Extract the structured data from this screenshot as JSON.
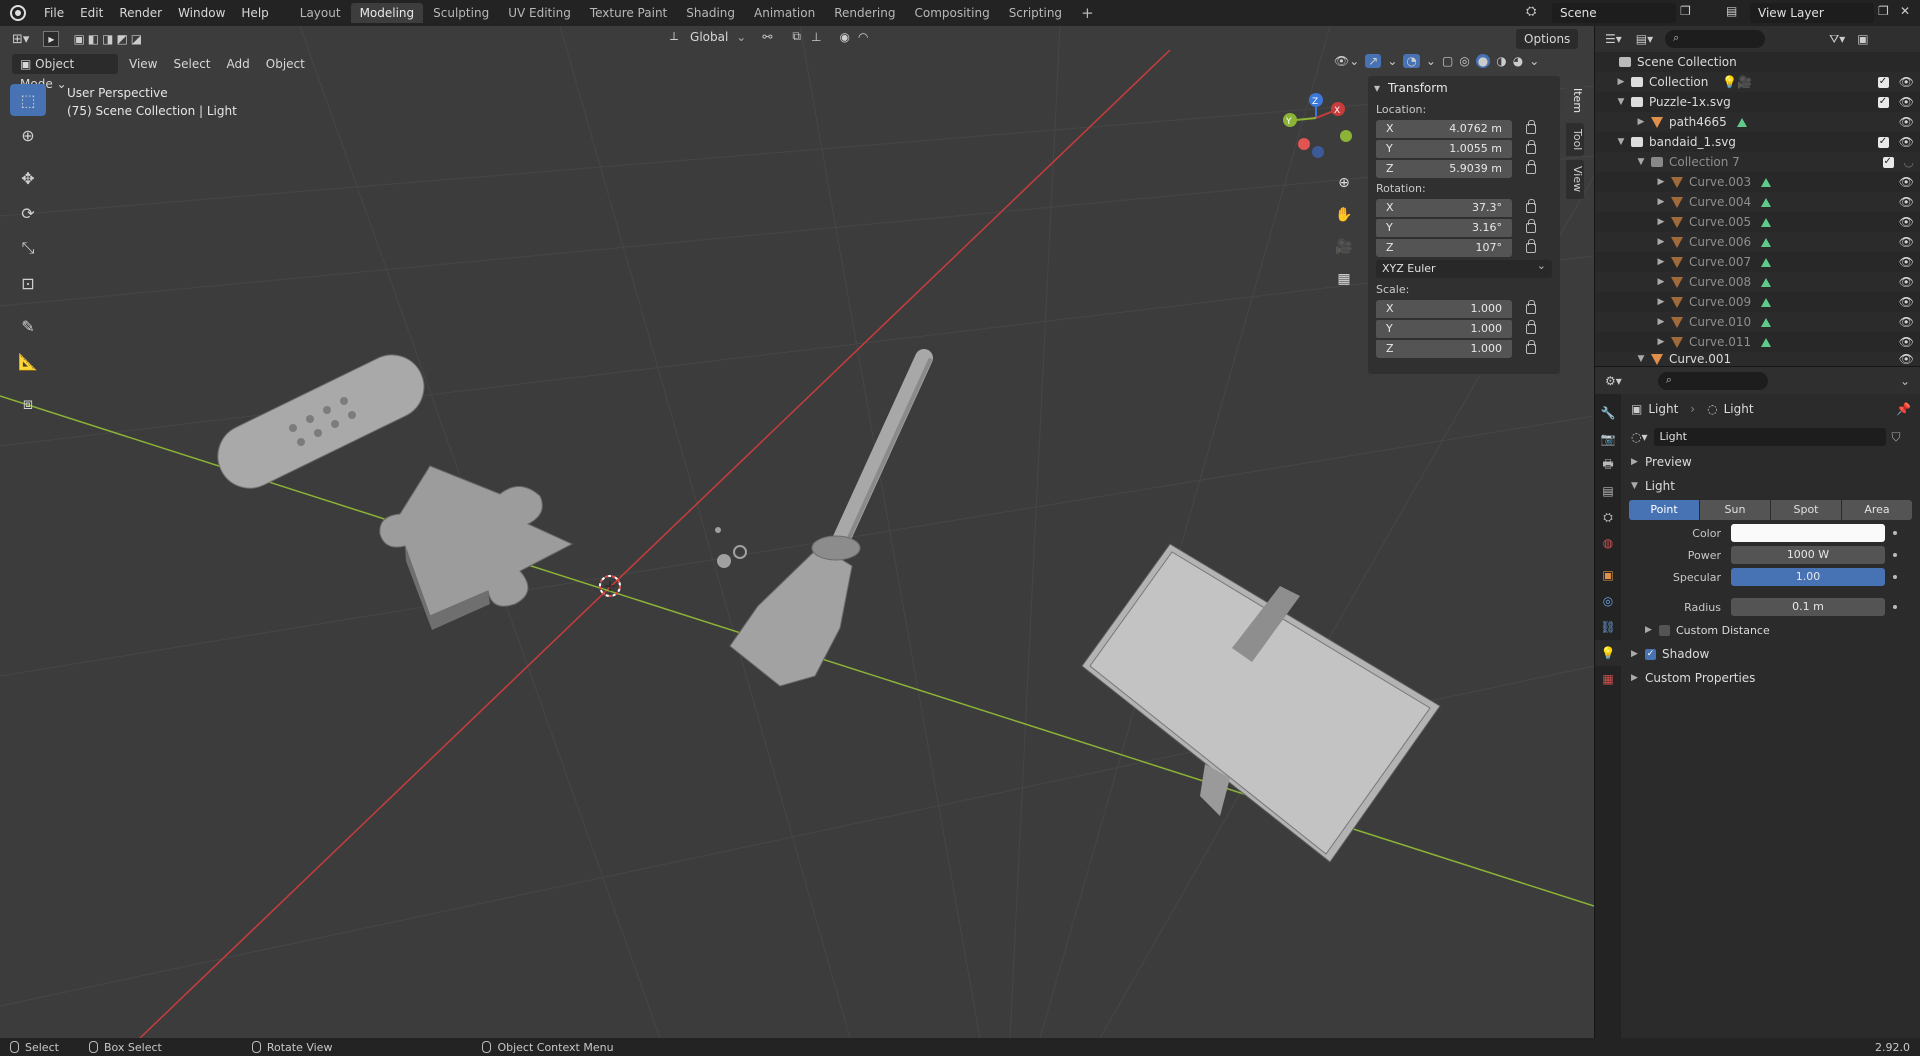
{
  "topbar": {
    "menus": [
      "File",
      "Edit",
      "Render",
      "Window",
      "Help"
    ],
    "workspaces": [
      "Layout",
      "Modeling",
      "Sculpting",
      "UV Editing",
      "Texture Paint",
      "Shading",
      "Animation",
      "Rendering",
      "Compositing",
      "Scripting"
    ],
    "active_workspace": "Modeling",
    "add_tab": "+",
    "scene": "Scene",
    "view_layer": "View Layer"
  },
  "viewport": {
    "mode": "Object Mode",
    "menus": [
      "View",
      "Select",
      "Add",
      "Object"
    ],
    "orientation": "Global",
    "options": "Options",
    "info_line1": "User Perspective",
    "info_line2": "(75) Scene Collection | Light"
  },
  "npanel": {
    "title": "Transform",
    "location_label": "Location:",
    "location": [
      {
        "axis": "X",
        "value": "4.0762 m"
      },
      {
        "axis": "Y",
        "value": "1.0055 m"
      },
      {
        "axis": "Z",
        "value": "5.9039 m"
      }
    ],
    "rotation_label": "Rotation:",
    "rotation": [
      {
        "axis": "X",
        "value": "37.3°"
      },
      {
        "axis": "Y",
        "value": "3.16°"
      },
      {
        "axis": "Z",
        "value": "107°"
      }
    ],
    "rotation_mode": "XYZ Euler",
    "scale_label": "Scale:",
    "scale": [
      {
        "axis": "X",
        "value": "1.000"
      },
      {
        "axis": "Y",
        "value": "1.000"
      },
      {
        "axis": "Z",
        "value": "1.000"
      }
    ],
    "tabs": [
      "Item",
      "Tool",
      "View"
    ]
  },
  "outliner": {
    "rows": [
      {
        "name": "Scene Collection",
        "indent": 0,
        "type": "scene"
      },
      {
        "name": "Collection",
        "indent": 1,
        "type": "coll"
      },
      {
        "name": "Puzzle-1x.svg",
        "indent": 1,
        "type": "coll"
      },
      {
        "name": "path4665",
        "indent": 2,
        "type": "curve"
      },
      {
        "name": "bandaid_1.svg",
        "indent": 1,
        "type": "coll"
      },
      {
        "name": "Collection 7",
        "indent": 2,
        "type": "coll",
        "dim": true
      },
      {
        "name": "Curve.003",
        "indent": 3,
        "type": "curve",
        "dim": true
      },
      {
        "name": "Curve.004",
        "indent": 3,
        "type": "curve",
        "dim": true
      },
      {
        "name": "Curve.005",
        "indent": 3,
        "type": "curve",
        "dim": true
      },
      {
        "name": "Curve.006",
        "indent": 3,
        "type": "curve",
        "dim": true
      },
      {
        "name": "Curve.007",
        "indent": 3,
        "type": "curve",
        "dim": true
      },
      {
        "name": "Curve.008",
        "indent": 3,
        "type": "curve",
        "dim": true
      },
      {
        "name": "Curve.009",
        "indent": 3,
        "type": "curve",
        "dim": true
      },
      {
        "name": "Curve.010",
        "indent": 3,
        "type": "curve",
        "dim": true
      },
      {
        "name": "Curve.011",
        "indent": 3,
        "type": "curve",
        "dim": true
      },
      {
        "name": "Curve.001",
        "indent": 2,
        "type": "curve"
      }
    ]
  },
  "properties": {
    "breadcrumb_object": "Light",
    "breadcrumb_data": "Light",
    "datablock_name": "Light",
    "preview": "Preview",
    "light_section": "Light",
    "light_types": [
      "Point",
      "Sun",
      "Spot",
      "Area"
    ],
    "active_type": "Point",
    "color_label": "Color",
    "power_label": "Power",
    "power_value": "1000 W",
    "specular_label": "Specular",
    "specular_value": "1.00",
    "radius_label": "Radius",
    "radius_value": "0.1 m",
    "custom_distance": "Custom Distance",
    "shadow": "Shadow",
    "custom_properties": "Custom Properties"
  },
  "statusbar": {
    "select": "Select",
    "box_select": "Box Select",
    "rotate_view": "Rotate View",
    "context_menu": "Object Context Menu",
    "version": "2.92.0"
  },
  "colors": {
    "accent": "#4772b3",
    "x_axis": "#c83c3c",
    "y_axis": "#8bb336",
    "z_axis": "#3c78d8"
  }
}
